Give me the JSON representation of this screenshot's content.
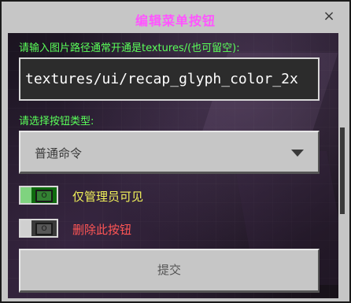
{
  "dialog": {
    "title": "编辑菜单按钮",
    "close_icon": "×"
  },
  "form": {
    "path_label": "请输入图片路径通常开通是textures/(也可留空):",
    "path_value": "textures/ui/recap_glyph_color_2x",
    "type_label": "请选择按钮类型:",
    "type_selected": "普通命令",
    "admin_only_label": "仅管理员可见",
    "admin_only_on": true,
    "delete_label": "删除此按钮",
    "delete_on": false,
    "submit_label": "提交"
  },
  "colors": {
    "title": "#ff55ff",
    "label_green": "#5aff5a",
    "admin_label": "#f2f25a",
    "delete_label": "#ff5555"
  }
}
